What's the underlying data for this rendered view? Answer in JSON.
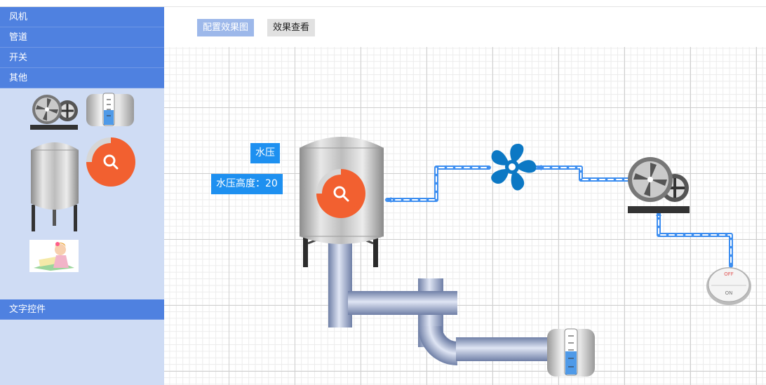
{
  "sidebar": {
    "categories": [
      "风机",
      "管道",
      "开关",
      "其他"
    ],
    "text_category": "文字控件"
  },
  "toolbar": {
    "config_label": "配置效果图",
    "view_label": "效果查看"
  },
  "canvas": {
    "water_pressure_label": "水压",
    "water_height_label": "水压高度：20"
  },
  "switch": {
    "off_text": "OFF",
    "on_text": "ON"
  },
  "colors": {
    "accent": "#4f81e0",
    "label_blue": "#1e90f0",
    "fan_blue": "#0c78c4",
    "magnifier_orange": "#f26030",
    "pipe_blue": "#3d8ef0"
  }
}
